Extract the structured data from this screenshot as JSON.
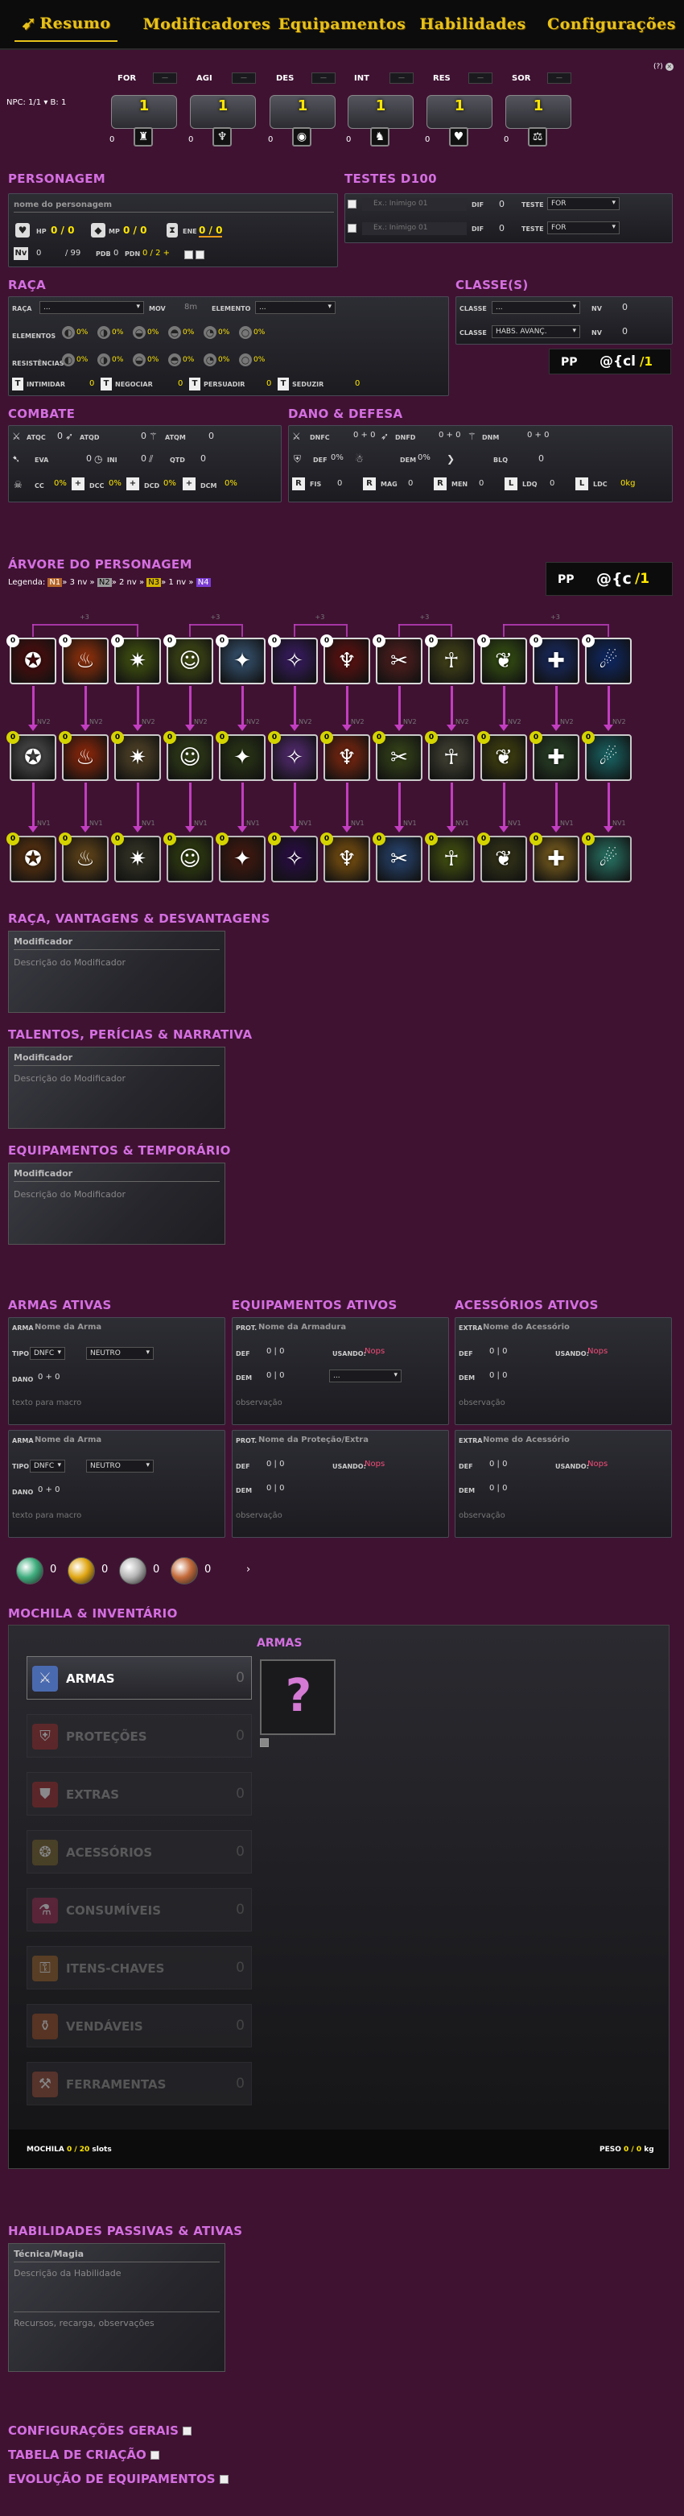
{
  "nav": {
    "tabs": [
      "Resumo",
      "Modificadores",
      "Equipamentos",
      "Habilidades",
      "Configurações"
    ],
    "help": "(?)"
  },
  "npc": {
    "label": "NPC:",
    "value": "1/1",
    "b_label": "B:",
    "b_value": "1"
  },
  "attributes": [
    {
      "name": "FOR",
      "value": "1",
      "mod": "0",
      "icon": "strength-icon"
    },
    {
      "name": "AGI",
      "value": "1",
      "mod": "0",
      "icon": "wings-icon"
    },
    {
      "name": "DES",
      "value": "1",
      "mod": "0",
      "icon": "eye-icon"
    },
    {
      "name": "INT",
      "value": "1",
      "mod": "0",
      "icon": "brain-icon"
    },
    {
      "name": "RES",
      "value": "1",
      "mod": "0",
      "icon": "heart-icon"
    },
    {
      "name": "SOR",
      "value": "1",
      "mod": "0",
      "icon": "scales-icon"
    }
  ],
  "attr_dash": "—",
  "personagem": {
    "title": "PERSONAGEM",
    "name_placeholder": "nome do personagem",
    "hp_label": "HP",
    "hp": "0 / 0",
    "mp_label": "MP",
    "mp": "0 / 0",
    "ene_label": "ENE",
    "ene": "0 / 0",
    "nv_label": "Nv",
    "nv": "0",
    "nv_max": "/ 99",
    "pdb_label": "PDB",
    "pdb": "0",
    "pdn_label": "PDN",
    "pdn": "0 / 2 +"
  },
  "testes": {
    "title": "TESTES D100",
    "rows": [
      {
        "placeholder": "Ex.: Inimigo 01",
        "dif_label": "DIF",
        "dif": "0",
        "teste_label": "TESTE",
        "teste": "FOR"
      },
      {
        "placeholder": "Ex.: Inimigo 01",
        "dif_label": "DIF",
        "dif": "0",
        "teste_label": "TESTE",
        "teste": "FOR"
      }
    ]
  },
  "raca": {
    "title": "RAÇA",
    "raca_label": "RAÇA",
    "raca_value": "...",
    "mov_label": "MOV",
    "mov": "8m",
    "elemento_label": "ELEMENTO",
    "elemento": "...",
    "elementos_label": "ELEMENTOS",
    "resistencias_label": "RESISTÊNCIAS",
    "pct": "0%",
    "skills": [
      {
        "label": "INTIMIDAR",
        "letter": "T",
        "value": "0"
      },
      {
        "label": "NEGOCIAR",
        "letter": "T",
        "value": "0"
      },
      {
        "label": "PERSUADIR",
        "letter": "T",
        "value": "0"
      },
      {
        "label": "SEDUZIR",
        "letter": "T",
        "value": "0"
      }
    ]
  },
  "classes": {
    "title": "CLASSE(S)",
    "rows": [
      {
        "label": "CLASSE",
        "value": "...",
        "nv_label": "NV",
        "nv": "0"
      },
      {
        "label": "CLASSE",
        "value": "HABS. AVANÇ.",
        "nv_label": "NV",
        "nv": "0"
      }
    ],
    "pp": "PP",
    "macro": "@{cl",
    "macro_num": "/1"
  },
  "combate": {
    "title": "COMBATE",
    "atqc": "ATQC",
    "atqd": "ATQD",
    "atqm": "ATQM",
    "eva": "EVA",
    "ini": "INI",
    "qtd": "QTD",
    "cc": "CC",
    "dcc": "DCC",
    "dcd": "DCD",
    "dcm": "DCM",
    "zero": "0",
    "pct": "0%"
  },
  "dano": {
    "title": "DANO & DEFESA",
    "dnfc": "DNFC",
    "dnfd": "DNFD",
    "dnm": "DNM",
    "def": "DEF",
    "dem": "DEM",
    "blq": "BLQ",
    "fis": "FIS",
    "mag": "MAG",
    "men": "MEN",
    "ldq": "LDQ",
    "ldc": "LDC",
    "ldc_val": "0kg",
    "sum": "0 + 0",
    "pct": "0%",
    "r": "R",
    "l": "L"
  },
  "arvore": {
    "title": "ÁRVORE DO PERSONAGEM",
    "legend": "Legenda:",
    "n1": "N1",
    "n2": "N2",
    "n3": "N3",
    "n4": "N4",
    "seg1": "» 3 nv »",
    "seg2": "» 2 nv »",
    "seg3": "» 1 nv »",
    "pp": "PP",
    "macro": "@{c",
    "macro_num": "/1",
    "nv2": "NV2",
    "nv1": "NV1",
    "x3": "+3",
    "row1": [
      {
        "badge": "0",
        "icon": "gear-icon",
        "bg": "#5a0d0d"
      },
      {
        "badge": "0",
        "icon": "fire-figure-icon",
        "bg": "#a0350b"
      },
      {
        "badge": "0",
        "icon": "spark-icon",
        "bg": "#495c10"
      },
      {
        "badge": "0",
        "icon": "figure-icon",
        "bg": "#4d5a16"
      },
      {
        "badge": "0",
        "icon": "light-icon",
        "bg": "#3a5a7a"
      },
      {
        "badge": "0",
        "icon": "purple-figure-icon",
        "bg": "#3d1d6a"
      },
      {
        "badge": "0",
        "icon": "demon-icon",
        "bg": "#6a1111"
      },
      {
        "badge": "0",
        "icon": "slash-icon",
        "bg": "#5a2020"
      },
      {
        "badge": "0",
        "icon": "warrior-icon",
        "bg": "#4a4a1a"
      },
      {
        "badge": "0",
        "icon": "kick-icon",
        "bg": "#3b5a12"
      },
      {
        "badge": "0",
        "icon": "medal-icon",
        "bg": "#1a2d6a"
      },
      {
        "badge": "0",
        "icon": "horizon-icon",
        "bg": "#0f2a6a"
      }
    ],
    "row2": [
      {
        "badge": "0",
        "icon": "crossed-swords-icon",
        "bg": "#5a5a5a"
      },
      {
        "badge": "0",
        "icon": "fire-slash-icon",
        "bg": "#9a2a0a"
      },
      {
        "badge": "0",
        "icon": "blade-icon",
        "bg": "#5a4a2a"
      },
      {
        "badge": "0",
        "icon": "target-icon",
        "bg": "#3a4a1a"
      },
      {
        "badge": "0",
        "icon": "shadow-icon",
        "bg": "#2d3a16"
      },
      {
        "badge": "0",
        "icon": "magic-burst-icon",
        "bg": "#5a2d7a"
      },
      {
        "badge": "0",
        "icon": "flame-hand-icon",
        "bg": "#8a2a10"
      },
      {
        "badge": "0",
        "icon": "hands-icon",
        "bg": "#3a4a1a"
      },
      {
        "badge": "0",
        "icon": "shield-figure-icon",
        "bg": "#4a4a3a"
      },
      {
        "badge": "0",
        "icon": "heal-icon",
        "bg": "#4a4a10"
      },
      {
        "badge": "0",
        "icon": "wolf-icon",
        "bg": "#2d4a2a"
      },
      {
        "badge": "0",
        "icon": "eye-icon",
        "bg": "#1a6a6a"
      }
    ],
    "row3": [
      {
        "badge": "0",
        "icon": "spear-icon",
        "bg": "#6a3a10"
      },
      {
        "badge": "0",
        "icon": "drum-icon",
        "bg": "#6a4a1a"
      },
      {
        "badge": "0",
        "icon": "shadow-blade-icon",
        "bg": "#3a3a2a"
      },
      {
        "badge": "0",
        "icon": "arrow-icon",
        "bg": "#3a4a10"
      },
      {
        "badge": "0",
        "icon": "warrior-icon",
        "bg": "#4a1a10"
      },
      {
        "badge": "0",
        "icon": "orb-icon",
        "bg": "#2d0d4a"
      },
      {
        "badge": "0",
        "icon": "sunburst-icon",
        "bg": "#8a5a10"
      },
      {
        "badge": "0",
        "icon": "person-icon",
        "bg": "#2a4a7a"
      },
      {
        "badge": "0",
        "icon": "lightning-icon",
        "bg": "#4a5a10"
      },
      {
        "badge": "0",
        "icon": "dancer-icon",
        "bg": "#3a3a1a"
      },
      {
        "badge": "0",
        "icon": "angel-icon",
        "bg": "#8a6a20"
      },
      {
        "badge": "0",
        "icon": "spirit-icon",
        "bg": "#2a7a6a"
      }
    ]
  },
  "mods": [
    {
      "title": "RAÇA, VANTAGENS & DESVANTAGENS",
      "name": "Modificador",
      "desc": "Descrição do Modificador"
    },
    {
      "title": "TALENTOS, PERÍCIAS & NARRATIVA",
      "name": "Modificador",
      "desc": "Descrição do Modificador"
    },
    {
      "title": "EQUIPAMENTOS & TEMPORÁRIO",
      "name": "Modificador",
      "desc": "Descrição do Modificador"
    }
  ],
  "armas": {
    "title": "ARMAS ATIVAS",
    "items": [
      {
        "tag": "ARMA",
        "name": "Nome da Arma",
        "tipo_label": "TIPO",
        "tipo": "DNFC",
        "elem": "NEUTRO",
        "dano_label": "DANO",
        "dano": "0 + 0",
        "macro": "texto para macro"
      },
      {
        "tag": "ARMA",
        "name": "Nome da Arma",
        "tipo_label": "TIPO",
        "tipo": "DNFC",
        "elem": "NEUTRO",
        "dano_label": "DANO",
        "dano": "0 + 0",
        "macro": "texto para macro"
      }
    ]
  },
  "equips": {
    "title": "EQUIPAMENTOS ATIVOS",
    "items": [
      {
        "tag": "PROT.",
        "name": "Nome da Armadura",
        "def_label": "DEF",
        "def": "0 | 0",
        "usando_label": "USANDO:",
        "usando": "Nops",
        "dem_label": "DEM",
        "dem": "0 | 0",
        "sel": "...",
        "obs": "observação"
      },
      {
        "tag": "PROT.",
        "name": "Nome da Proteção/Extra",
        "def_label": "DEF",
        "def": "0 | 0",
        "usando_label": "USANDO:",
        "usando": "Nops",
        "dem_label": "DEM",
        "dem": "0 | 0",
        "sel": "",
        "obs": "observação"
      }
    ]
  },
  "acess": {
    "title": "ACESSÓRIOS ATIVOS",
    "items": [
      {
        "tag": "EXTRA",
        "name": "Nome do Acessório",
        "def_label": "DEF",
        "def": "0 | 0",
        "usando_label": "USANDO:",
        "usando": "Nops",
        "dem_label": "DEM",
        "dem": "0 | 0",
        "obs": "observação"
      },
      {
        "tag": "EXTRA",
        "name": "Nome do Acessório",
        "def_label": "DEF",
        "def": "0 | 0",
        "usando_label": "USANDO:",
        "usando": "Nops",
        "dem_label": "DEM",
        "dem": "0 | 0",
        "obs": "observação"
      }
    ]
  },
  "coins": [
    {
      "icon": "platinum-coin-icon",
      "value": "0",
      "color": "#3fae7e"
    },
    {
      "icon": "gold-coin-icon",
      "value": "0",
      "color": "#e0a612"
    },
    {
      "icon": "silver-coin-icon",
      "value": "0",
      "color": "#b5b5b5"
    },
    {
      "icon": "copper-coin-icon",
      "value": "0",
      "color": "#c46a3a"
    }
  ],
  "coins_arrow": "›",
  "mochila": {
    "title": "MOCHILA & INVENTÁRIO",
    "categories": [
      {
        "label": "ARMAS",
        "count": "0",
        "icon": "sword-icon",
        "color": "#4a6ab0"
      },
      {
        "label": "PROTEÇÕES",
        "count": "0",
        "icon": "armor-icon",
        "color": "#8a2a2a"
      },
      {
        "label": "EXTRAS",
        "count": "0",
        "icon": "shield-icon",
        "color": "#8a2a2a"
      },
      {
        "label": "ACESSÓRIOS",
        "count": "0",
        "icon": "amulet-icon",
        "color": "#6a5a2a"
      },
      {
        "label": "CONSUMÍVEIS",
        "count": "0",
        "icon": "potion-icon",
        "color": "#8a2a4a"
      },
      {
        "label": "ITENS-CHAVES",
        "count": "0",
        "icon": "key-icon",
        "color": "#8a5a2a"
      },
      {
        "label": "VENDÁVEIS",
        "count": "0",
        "icon": "sack-icon",
        "color": "#8a4a2a"
      },
      {
        "label": "FERRAMENTAS",
        "count": "0",
        "icon": "tools-icon",
        "color": "#8a4a3a"
      }
    ],
    "section": "ARMAS",
    "slots_label": "MOCHILA",
    "slots": "0 / 20",
    "slots_unit": "slots",
    "peso_label": "PESO",
    "peso": "0 / 0",
    "peso_unit": "kg"
  },
  "habilidades": {
    "title": "HABILIDADES PASSIVAS & ATIVAS",
    "name": "Técnica/Magia",
    "desc": "Descrição da Habilidade",
    "rec": "Recursos, recarga, observações"
  },
  "footer": [
    "CONFIGURAÇÕES GERAIS",
    "TABELA DE CRIAÇÃO",
    "EVOLUÇÃO DE EQUIPAMENTOS"
  ]
}
